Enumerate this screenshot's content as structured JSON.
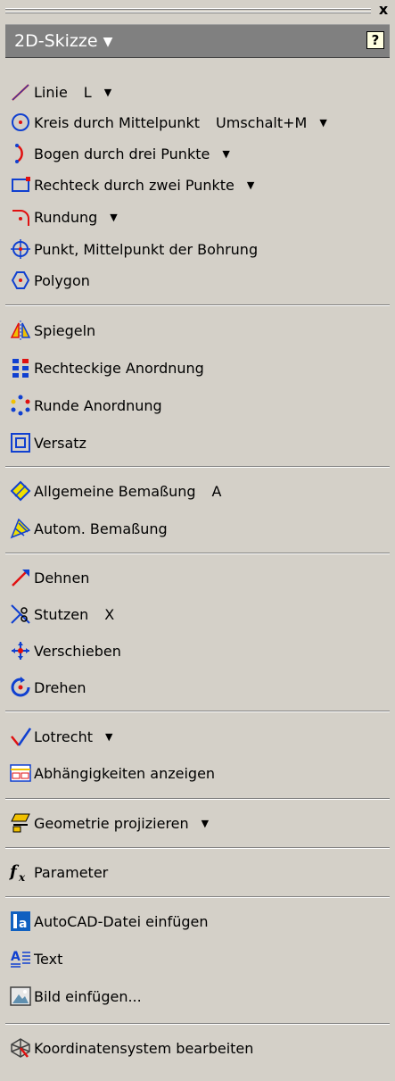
{
  "panel": {
    "title": "2D-Skizze",
    "title_caret": "▼",
    "help": "?",
    "close": "x"
  },
  "items": [
    {
      "label": "Linie",
      "shortcut": "L",
      "dropdown": "▼",
      "icon": "line-icon"
    },
    {
      "label": "Kreis durch Mittelpunkt",
      "shortcut": "Umschalt+M",
      "dropdown": "▼",
      "icon": "circle-center-icon"
    },
    {
      "label": "Bogen durch drei Punkte",
      "dropdown": "▼",
      "icon": "arc-three-points-icon"
    },
    {
      "label": "Rechteck durch zwei Punkte",
      "dropdown": "▼",
      "icon": "rectangle-icon"
    },
    {
      "label": "Rundung",
      "dropdown": "▼",
      "icon": "fillet-icon"
    },
    {
      "label": "Punkt, Mittelpunkt der Bohrung",
      "icon": "point-hole-center-icon"
    },
    {
      "label": "Polygon",
      "icon": "polygon-icon"
    },
    {
      "label": "Spiegeln",
      "icon": "mirror-icon"
    },
    {
      "label": "Rechteckige Anordnung",
      "icon": "rectangular-pattern-icon"
    },
    {
      "label": "Runde Anordnung",
      "icon": "circular-pattern-icon"
    },
    {
      "label": "Versatz",
      "icon": "offset-icon"
    },
    {
      "label": "Allgemeine Bemaßung",
      "shortcut": "A",
      "icon": "general-dimension-icon"
    },
    {
      "label": "Autom. Bemaßung",
      "icon": "auto-dimension-icon"
    },
    {
      "label": "Dehnen",
      "icon": "extend-icon"
    },
    {
      "label": "Stutzen",
      "shortcut": "X",
      "icon": "trim-icon"
    },
    {
      "label": "Verschieben",
      "icon": "move-icon"
    },
    {
      "label": "Drehen",
      "icon": "rotate-icon"
    },
    {
      "label": "Lotrecht",
      "dropdown": "▼",
      "icon": "perpendicular-icon"
    },
    {
      "label": "Abhängigkeiten anzeigen",
      "icon": "show-constraints-icon"
    },
    {
      "label": "Geometrie projizieren",
      "dropdown": "▼",
      "icon": "project-geometry-icon"
    },
    {
      "label": "Parameter",
      "icon": "parameter-fx-icon"
    },
    {
      "label": "AutoCAD-Datei einfügen",
      "icon": "autocad-insert-icon"
    },
    {
      "label": "Text",
      "icon": "text-icon"
    },
    {
      "label": "Bild einfügen...",
      "icon": "insert-image-icon"
    },
    {
      "label": "Koordinatensystem bearbeiten",
      "icon": "coordinate-system-icon"
    }
  ],
  "colors": {
    "background": "#d4d0c8",
    "header": "#808080",
    "accent_red": "#e01010",
    "accent_blue": "#1040d0"
  }
}
